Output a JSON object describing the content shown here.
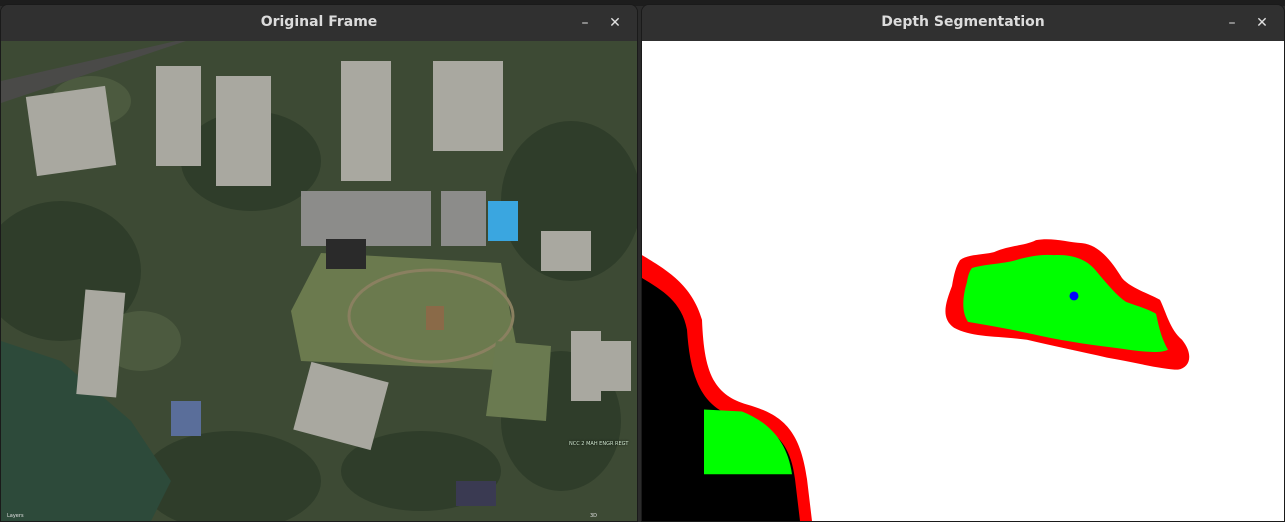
{
  "left_window": {
    "title": "Original Frame",
    "min_glyph": "–",
    "close_glyph": "✕",
    "map_labels": [
      "NCC 2 MAH ENGR REGT"
    ],
    "status_left": "Layers",
    "status_right": "3D"
  },
  "right_window": {
    "title": "Depth Segmentation",
    "min_glyph": "–",
    "close_glyph": "✕"
  },
  "colors": {
    "segment_fill": "#00ff00",
    "segment_border": "#ff0000",
    "background": "#ffffff",
    "obstacle": "#000000",
    "centroid": "#0000ff"
  }
}
